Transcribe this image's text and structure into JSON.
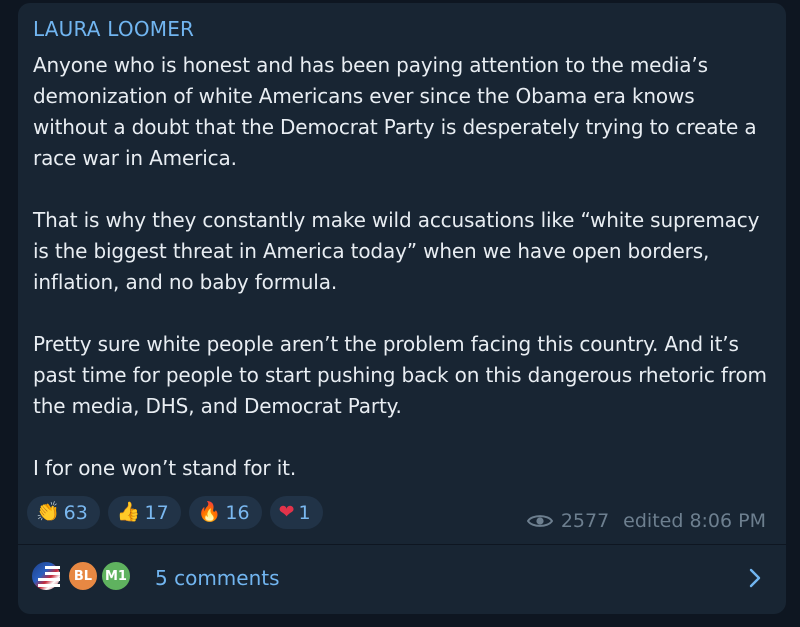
{
  "post": {
    "author": "LAURA LOOMER",
    "paragraphs": [
      "Anyone who is honest and has been paying attention to the media’s demonization of white Americans ever since the Obama era knows without a doubt that the Democrat Party is desperately trying to create a race war in America.",
      "That is why they constantly make wild accusations like “white supremacy is the biggest threat in America today” when we have open borders, inflation, and no baby formula.",
      "Pretty sure white people aren’t the problem facing this country. And it’s past time for people to start pushing back on this dangerous rhetoric from the media, DHS, and Democrat Party.",
      "I for one won’t stand for it."
    ]
  },
  "reactions": [
    {
      "icon": "clapping-hands-emoji",
      "emoji": "👏",
      "count": "63"
    },
    {
      "icon": "thumbs-up-emoji",
      "emoji": "👍",
      "count": "17"
    },
    {
      "icon": "fire-emoji",
      "emoji": "🔥",
      "count": "16"
    },
    {
      "icon": "red-heart-emoji",
      "emoji": "❤",
      "count": "1"
    }
  ],
  "meta": {
    "views": "2577",
    "edited": "edited 8:06 PM"
  },
  "comments": {
    "avatars": [
      {
        "initials": "",
        "icon": "flag-avatar"
      },
      {
        "initials": "BL",
        "color": "#e78843"
      },
      {
        "initials": "M1",
        "color": "#5fb25f"
      }
    ],
    "label": "5 comments"
  },
  "colors": {
    "background": "#0e1621",
    "bubble": "#182533",
    "accent": "#71b5f0",
    "text": "#e8edf2",
    "muted": "#6d7f8f"
  }
}
